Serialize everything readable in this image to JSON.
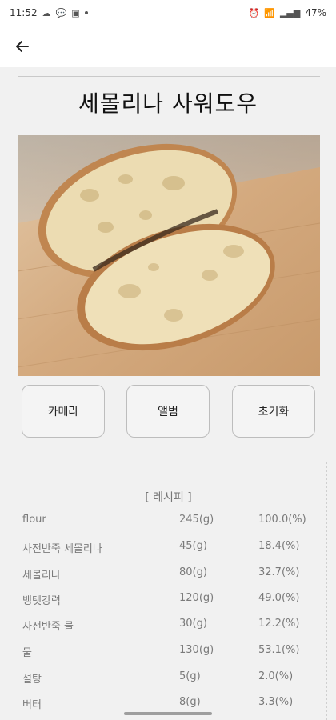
{
  "status_bar": {
    "time": "11:52",
    "battery": "47%"
  },
  "header": {
    "back_icon": "back-arrow-icon"
  },
  "page": {
    "title": "세몰리나 사워도우"
  },
  "buttons": {
    "camera": "카메라",
    "album": "앨범",
    "reset": "초기화"
  },
  "recipe": {
    "header": "[ 레시피 ]",
    "rows": [
      {
        "name": "flour",
        "qty": "245(g)",
        "pct": "100.0(%)"
      },
      {
        "name": "사전반죽 세몰리나",
        "qty": "45(g)",
        "pct": "18.4(%)"
      },
      {
        "name": "세몰리나",
        "qty": "80(g)",
        "pct": "32.7(%)"
      },
      {
        "name": "뱅텟강력",
        "qty": "120(g)",
        "pct": "49.0(%)"
      },
      {
        "name": "사전반죽 물",
        "qty": "30(g)",
        "pct": "12.2(%)"
      },
      {
        "name": "물",
        "qty": "130(g)",
        "pct": "53.1(%)"
      },
      {
        "name": "설탕",
        "qty": "5(g)",
        "pct": "2.0(%)"
      },
      {
        "name": "버터",
        "qty": "8(g)",
        "pct": "3.3(%)"
      }
    ]
  }
}
